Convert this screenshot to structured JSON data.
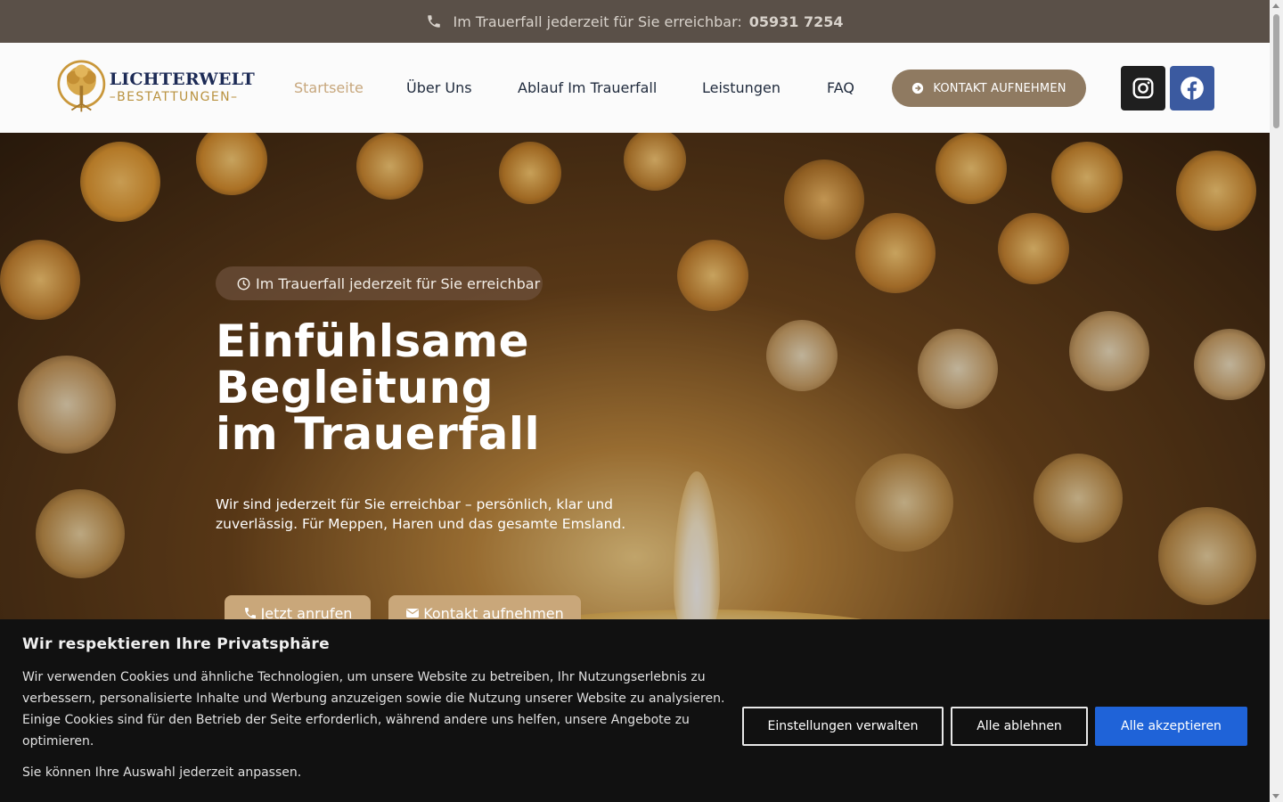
{
  "topbar": {
    "text": "Im Trauerfall jederzeit für Sie erreichbar:",
    "phone": "05931 7254"
  },
  "logo": {
    "line1": "LICHTERWELT",
    "line2": "BESTATTUNGEN"
  },
  "nav": {
    "items": [
      {
        "label": "Startseite",
        "active": true
      },
      {
        "label": "Über Uns"
      },
      {
        "label": "Ablauf Im Trauerfall"
      },
      {
        "label": "Leistungen"
      },
      {
        "label": "FAQ"
      }
    ],
    "cta": "KONTAKT AUFNEHMEN"
  },
  "social": {
    "instagram_icon": "instagram-icon",
    "facebook_icon": "facebook-icon"
  },
  "hero": {
    "badge": "Im Trauerfall jederzeit für Sie erreichbar",
    "title_lines": [
      "Einfühlsame",
      "Begleitung",
      "im Trauerfall"
    ],
    "subtitle": "Wir sind jederzeit für Sie erreichbar – persönlich, klar und zuverlässig. Für Meppen, Haren und das gesamte Emsland.",
    "call_button": "Jetzt anrufen",
    "contact_button": "Kontakt aufnehmen"
  },
  "cookie": {
    "title": "Wir respektieren Ihre Privatsphäre",
    "body": "Wir verwenden Cookies und ähnliche Technologien, um unsere Website zu betreiben, Ihr Nutzungserlebnis zu verbessern, personalisierte Inhalte und Werbung anzuzeigen sowie die Nutzung unserer Website zu analysieren. Einige Cookies sind für den Betrieb der Seite erforderlich, während andere uns helfen, unsere Angebote zu optimieren.",
    "note": "Sie können Ihre Auswahl jederzeit anpassen.",
    "settings_button": "Einstellungen verwalten",
    "reject_button": "Alle ablehnen",
    "accept_button": "Alle akzeptieren"
  },
  "colors": {
    "topbar_bg": "#5a5048",
    "accent": "#c9a77a",
    "cta_bg": "#8f7a61",
    "accept_blue": "#1f63d8",
    "facebook_blue": "#3b5aa0"
  }
}
